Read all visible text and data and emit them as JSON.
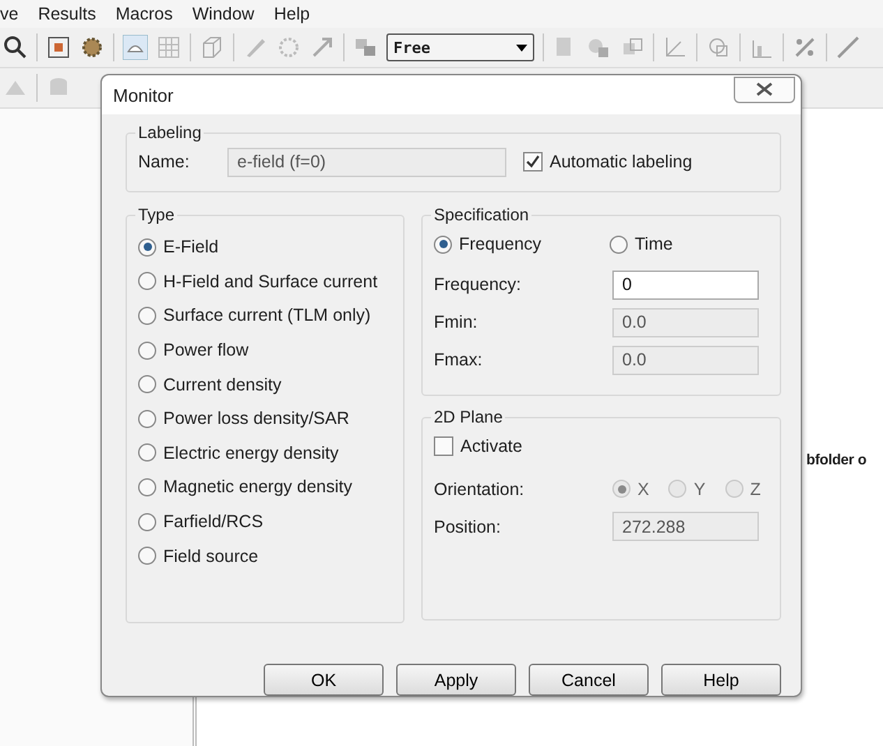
{
  "menu": [
    {
      "label": "ve"
    },
    {
      "label": "Results"
    },
    {
      "label": "Macros"
    },
    {
      "label": "Window"
    },
    {
      "label": "Help"
    }
  ],
  "toolbar": {
    "dropdown": "Free"
  },
  "workspace": {
    "text": "bfolder o"
  },
  "dialog": {
    "title": "Monitor",
    "labeling": {
      "title": "Labeling",
      "name_label": "Name:",
      "name_value": "e-field (f=0)",
      "auto": {
        "label": "Automatic labeling",
        "checked": true
      }
    },
    "type": {
      "title": "Type",
      "options": [
        {
          "label": "E-Field",
          "selected": true
        },
        {
          "label": "H-Field and Surface current",
          "selected": false
        },
        {
          "label": "Surface current (TLM only)",
          "selected": false
        },
        {
          "label": "Power flow",
          "selected": false
        },
        {
          "label": "Current density",
          "selected": false
        },
        {
          "label": "Power loss density/SAR",
          "selected": false
        },
        {
          "label": "Electric energy density",
          "selected": false
        },
        {
          "label": "Magnetic energy density",
          "selected": false
        },
        {
          "label": "Farfield/RCS",
          "selected": false
        },
        {
          "label": "Field source",
          "selected": false
        }
      ]
    },
    "specification": {
      "title": "Specification",
      "modes": [
        {
          "label": "Frequency",
          "selected": true
        },
        {
          "label": "Time",
          "selected": false
        }
      ],
      "fields": [
        {
          "label": "Frequency:",
          "value": "0",
          "disabled": false
        },
        {
          "label": "Fmin:",
          "value": "0.0",
          "disabled": true
        },
        {
          "label": "Fmax:",
          "value": "0.0",
          "disabled": true
        }
      ]
    },
    "plane": {
      "title": "2D Plane",
      "activate": {
        "label": "Activate",
        "checked": false
      },
      "orientation_label": "Orientation:",
      "axes": [
        {
          "label": "X",
          "selected": true,
          "disabled": true
        },
        {
          "label": "Y",
          "selected": false,
          "disabled": true
        },
        {
          "label": "Z",
          "selected": false,
          "disabled": true
        }
      ],
      "position_label": "Position:",
      "position_value": "272.288",
      "position_disabled": true
    },
    "buttons": [
      {
        "label": "OK"
      },
      {
        "label": "Apply"
      },
      {
        "label": "Cancel"
      },
      {
        "label": "Help"
      }
    ]
  }
}
